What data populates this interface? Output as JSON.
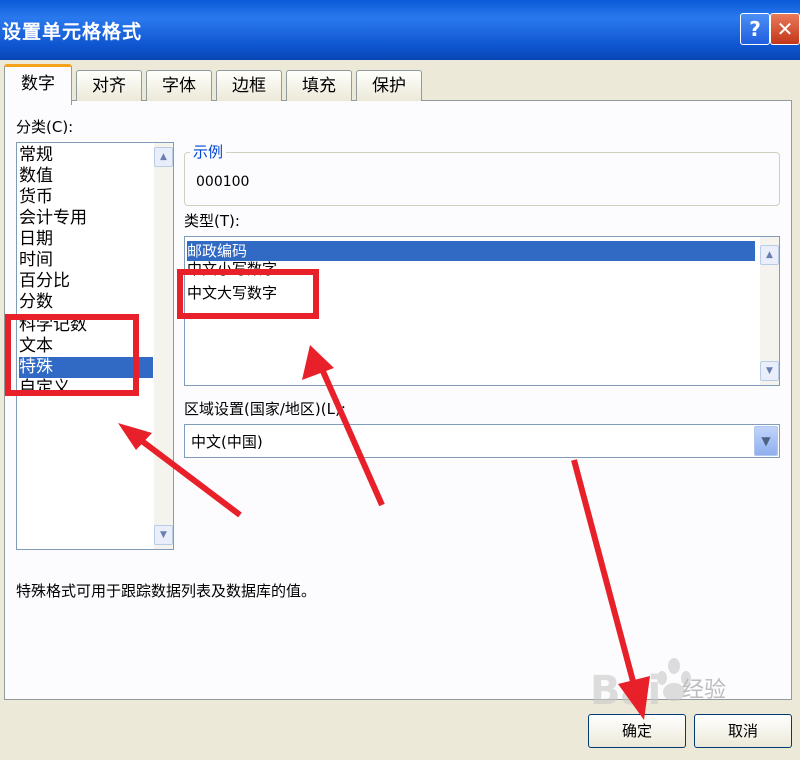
{
  "window": {
    "title": "设置单元格格式",
    "help_label": "?",
    "close_label": "✕"
  },
  "tabs": [
    {
      "label": "数字",
      "selected": true
    },
    {
      "label": "对齐",
      "selected": false
    },
    {
      "label": "字体",
      "selected": false
    },
    {
      "label": "边框",
      "selected": false
    },
    {
      "label": "填充",
      "selected": false
    },
    {
      "label": "保护",
      "selected": false
    }
  ],
  "category": {
    "label": "分类(C):",
    "items": [
      "常规",
      "数值",
      "货币",
      "会计专用",
      "日期",
      "时间",
      "百分比",
      "分数",
      "科学记数",
      "文本",
      "特殊",
      "自定义"
    ],
    "selected_index": 10
  },
  "sample": {
    "legend": "示例",
    "value": "000100"
  },
  "type": {
    "label": "类型(T):",
    "items": [
      "邮政编码",
      "中文小写数字",
      "中文大写数字"
    ],
    "selected_index": 0
  },
  "locale": {
    "label": "区域设置(国家/地区)(L):",
    "value": "中文(中国)"
  },
  "description": "特殊格式可用于跟踪数据列表及数据库的值。",
  "buttons": {
    "ok": "确定",
    "cancel": "取消"
  },
  "watermark": {
    "logo_text": "Bai",
    "text": "经验"
  },
  "colors": {
    "title_bar": "#0a5ad8",
    "selection": "#316ac5",
    "annotation": "#e8202a",
    "dialog_bg": "#ece9d8"
  }
}
